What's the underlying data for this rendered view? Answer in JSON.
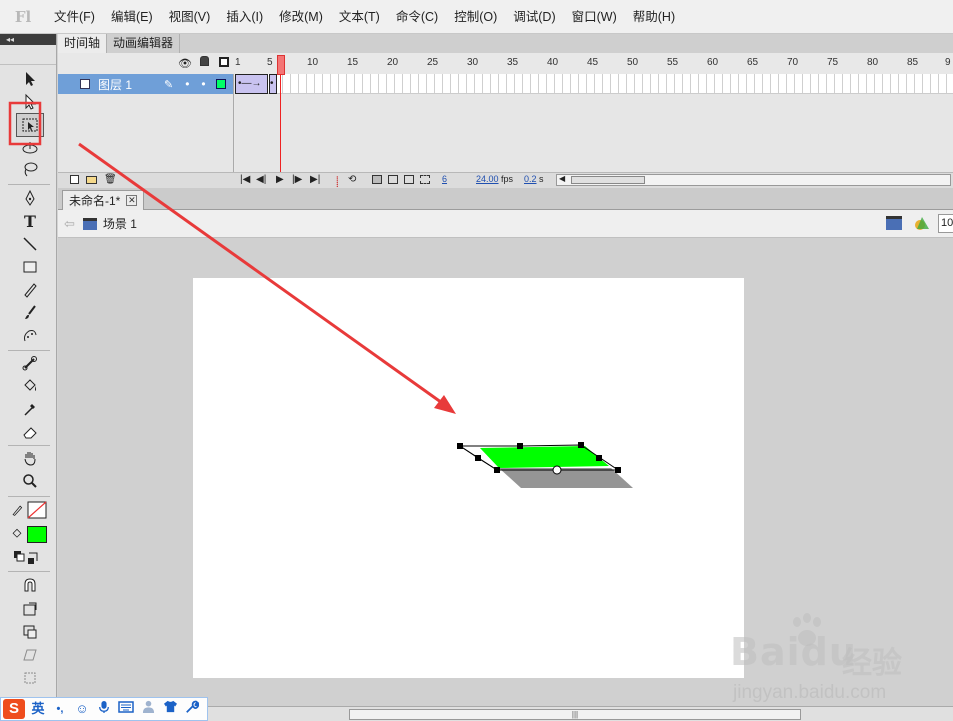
{
  "app": {
    "logo": "Fl"
  },
  "menu": [
    "文件(F)",
    "编辑(E)",
    "视图(V)",
    "插入(I)",
    "修改(M)",
    "文本(T)",
    "命令(C)",
    "控制(O)",
    "调试(D)",
    "窗口(W)",
    "帮助(H)"
  ],
  "tools": {
    "collapse_label": "◂◂",
    "text_tool_glyph": "T"
  },
  "timeline": {
    "tabs": [
      "时间轴",
      "动画编辑器"
    ],
    "ruler": [
      "1",
      "5",
      "10",
      "15",
      "20",
      "25",
      "30",
      "35",
      "40",
      "45",
      "50",
      "55",
      "60",
      "65",
      "70",
      "75",
      "80",
      "85",
      "9"
    ],
    "layer_name": "图层 1",
    "current_frame": "6",
    "fps": "24.00",
    "fps_unit": "fps",
    "time": "0.2",
    "time_unit": "s"
  },
  "document": {
    "tab_label": "未命名-1*",
    "close_glyph": "✕",
    "scene": "场景 1",
    "zoom_partial": "10"
  },
  "ime": {
    "logo": "S",
    "mode": "英",
    "punct": "•,"
  },
  "watermark": {
    "brand": "Baidu",
    "brand_cn": "经验",
    "url": "jingyan.baidu.com"
  },
  "colors": {
    "fill": "#00ff00",
    "shadow": "#8a8a8a",
    "annotation": "#e83a3a",
    "layer_highlight": "#6f9fd8"
  }
}
